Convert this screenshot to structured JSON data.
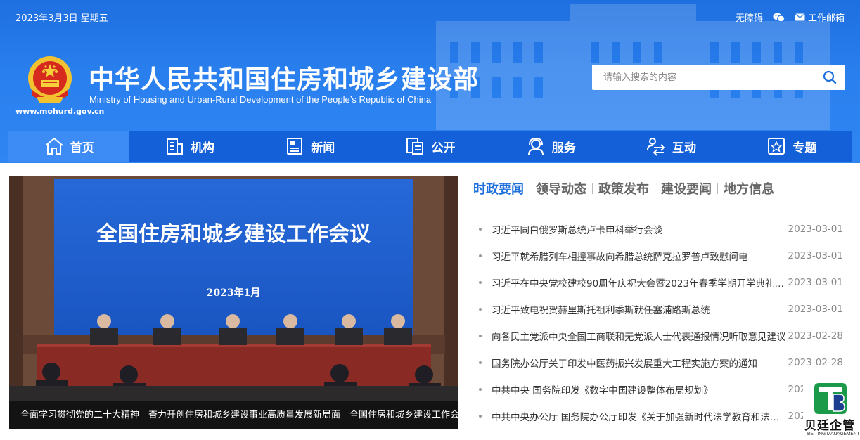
{
  "topbar": {
    "date": "2023年3月3日 星期五",
    "accessibility_label": "无障碍",
    "mail_label": "工作邮箱"
  },
  "site": {
    "url": "www.mohurd.gov.cn",
    "title": "中华人民共和国住房和城乡建设部",
    "subtitle": "Ministry of Housing and Urban-Rural Development of the People’s Republic of China"
  },
  "search": {
    "placeholder": "请输入搜索的内容"
  },
  "nav": [
    {
      "label": "首页",
      "icon": "home-icon",
      "active": true
    },
    {
      "label": "机构",
      "icon": "building-icon"
    },
    {
      "label": "新闻",
      "icon": "newspaper-icon"
    },
    {
      "label": "公开",
      "icon": "document-icon"
    },
    {
      "label": "服务",
      "icon": "service-person-icon"
    },
    {
      "label": "互动",
      "icon": "interaction-arrows-icon"
    },
    {
      "label": "专题",
      "icon": "star-frame-icon"
    }
  ],
  "hero": {
    "screen_title": "全国住房和城乡建设工作会议",
    "screen_date": "2023年1月",
    "caption": "全面学习贯彻党的二十大精神　奋力开创住房和城乡建设事业高质量发展新局面　全国住房和城乡建设工作会议在京召开"
  },
  "tabs": [
    "时政要闻",
    "领导动态",
    "政策发布",
    "建设要闻",
    "地方信息"
  ],
  "news": [
    {
      "title": "习近平同白俄罗斯总统卢卡申科举行会谈",
      "date": "2023-03-01"
    },
    {
      "title": "习近平就希腊列车相撞事故向希腊总统萨克拉罗普卢致慰问电",
      "date": "2023-03-01"
    },
    {
      "title": "习近平在中央党校建校90周年庆祝大会暨2023年春季学期开学典礼上发表重要讲话",
      "date": "2023-03-01"
    },
    {
      "title": "习近平致电祝贺赫里斯托祖利季斯就任塞浦路斯总统",
      "date": "2023-03-01"
    },
    {
      "title": "向各民主党派中央全国工商联和无党派人士代表通报情况听取意见建议",
      "date": "2023-02-28"
    },
    {
      "title": "国务院办公厅关于印发中医药振兴发展重大工程实施方案的通知",
      "date": "2023-02-28"
    },
    {
      "title": "中共中央 国务院印发《数字中国建设整体布局规划》",
      "date": "2023-02-27"
    },
    {
      "title": "中共中央办公厅 国务院办公厅印发《关于加强新时代法学教育和法学理论研究的意见》",
      "date": "2023-02-26"
    }
  ],
  "watermark": {
    "zh": "贝廷企管",
    "en": "BEITING MANAGEMENT"
  },
  "colors": {
    "brand_blue": "#2a7fee",
    "nav_blue": "#1460d8",
    "active_tab": "#1d6fdc"
  }
}
